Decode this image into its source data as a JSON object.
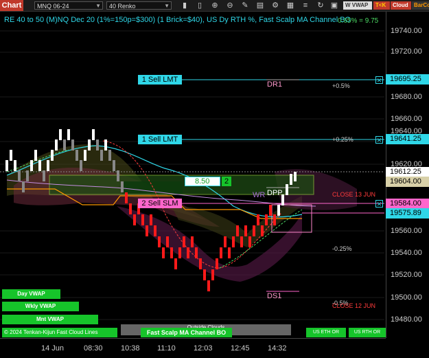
{
  "toolbar": {
    "chart_label": "Chart",
    "instrument": "MNQ 06-24",
    "bar_type": "40 Renko",
    "vwap_label": "W VWAP",
    "tk_label": "T<K",
    "cloud_label": "Cloud",
    "barcolor_label": "BarCo"
  },
  "chart": {
    "title": "RE 40 to 50 (M)NQ Dec 20 (1%=150p=$300) (1 Brick=$40), US Dy RTH %, Fast Scalp MA Channel BO",
    "title_right": "0.65% = 9.75",
    "orders": [
      {
        "label": "1 Sell LMT",
        "price": "19695.25"
      },
      {
        "label": "1 Sell LMT",
        "price": "19641.25"
      },
      {
        "label": "2 Sell SLM",
        "price": "19584.00"
      }
    ],
    "position": {
      "price": "8.50",
      "qty": "2"
    },
    "levels": {
      "dr1": "DR1",
      "ds1": "DS1",
      "dpp": "DPP",
      "wr": "WR",
      "plus05": "+0.5%",
      "plus025": "+0.25%",
      "minus025": "-0.25%",
      "minus05": "-0.5%",
      "close13": "CLOSE 13 JUN",
      "close12": "CLOSE 12 JUN"
    },
    "indicators": {
      "day_vwap": "Day VWAP",
      "wkly_vwap": "Wkly VWAP",
      "mnt_vwap": "Mnt VWAP",
      "copyright": "© 2024 Tenkan-Kijun Fast Cloud Lines",
      "outside_clouds": "Outside Clouds",
      "fast_scalp": "Fast Scalp MA Channel BO",
      "us_eth_or": "US ETH OR",
      "us_rth_or": "US RTH OR"
    },
    "price_ticks": [
      "19740.00",
      "19720.00",
      "19680.00",
      "19660.00",
      "19640.00",
      "19620.00",
      "19560.00",
      "19540.00",
      "19520.00",
      "19500.00",
      "19480.00"
    ],
    "price_tags": {
      "last": "19612.25",
      "p604": "19604.00",
      "p575": "19575.89"
    },
    "time_labels": [
      "14 Jun",
      "08:30",
      "10:38",
      "11:10",
      "12:03",
      "12:45",
      "14:32"
    ],
    "colors": {
      "accent_cyan": "#2fd7e8",
      "sell_pink": "#ff66cc",
      "up_brick": "#ffffff",
      "down_brick": "#ff1a1a",
      "green": "#16c42a",
      "orange": "#ff9900"
    }
  }
}
